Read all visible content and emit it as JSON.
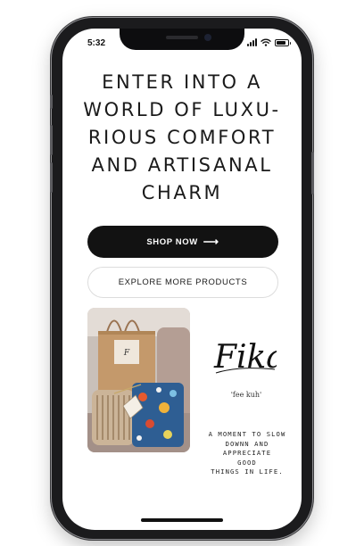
{
  "status_bar": {
    "time": "5:32",
    "icons": [
      "cellular-signal-icon",
      "wifi-icon",
      "battery-icon"
    ]
  },
  "hero": {
    "headline": "ENTER INTO A WORLD OF LUXU- RIOUS COMFORT AND ARTISANAL CHARM"
  },
  "buttons": {
    "shop_now_label": "SHOP NOW",
    "shop_now_icon": "arrow-right-icon",
    "explore_label": "EXPLORE MORE PRODUCTS"
  },
  "brand": {
    "logo_text": "Fika",
    "pronunciation": "'fee kuh'",
    "tagline": "A MOMENT TO SLOW\nDOWNN AND\nAPPRECIATE\nGOOD\nTHINGS IN LIFE."
  },
  "colors": {
    "button_dark": "#121212",
    "text_dark": "#1a1a1a",
    "screen_bg": "#ffffff"
  }
}
